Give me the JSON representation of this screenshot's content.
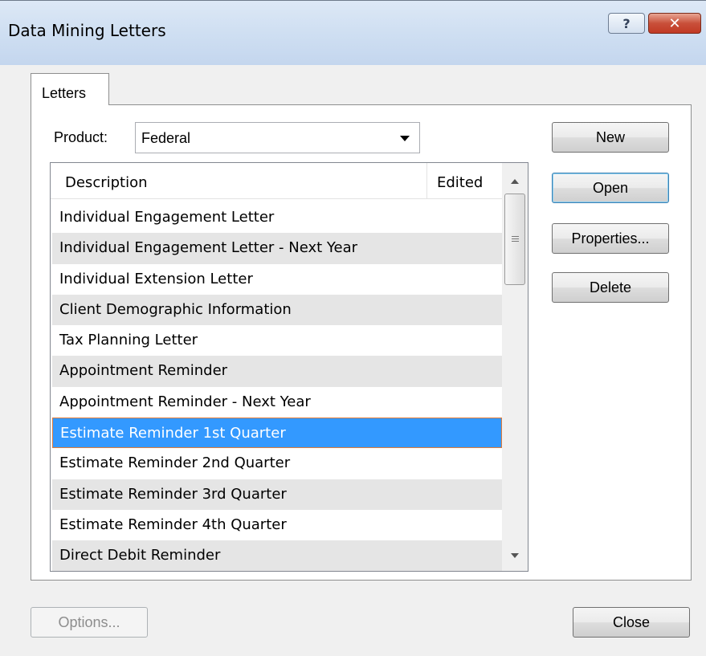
{
  "window": {
    "title": "Data Mining Letters",
    "help_label": "?",
    "close_label": "✕"
  },
  "tabs": [
    {
      "label": "Letters"
    }
  ],
  "product": {
    "label": "Product:",
    "selected": "Federal"
  },
  "list": {
    "columns": [
      "Description",
      "Edited"
    ],
    "rows": [
      "Individual Engagement Letter",
      "Individual Engagement Letter - Next Year",
      "Individual Extension Letter",
      "Client Demographic Information",
      "Tax Planning Letter",
      "Appointment Reminder",
      "Appointment Reminder - Next Year",
      "Estimate Reminder 1st Quarter",
      "Estimate Reminder 2nd Quarter",
      "Estimate Reminder 3rd Quarter",
      "Estimate Reminder 4th Quarter",
      "Direct Debit Reminder"
    ],
    "selected_index": 7
  },
  "buttons": {
    "new": "New",
    "open": "Open",
    "properties": "Properties...",
    "delete": "Delete",
    "options": "Options...",
    "close": "Close"
  },
  "colors": {
    "selection": "#3399ff",
    "selection_border": "#e07b39",
    "alt_row": "#e5e5e5"
  }
}
